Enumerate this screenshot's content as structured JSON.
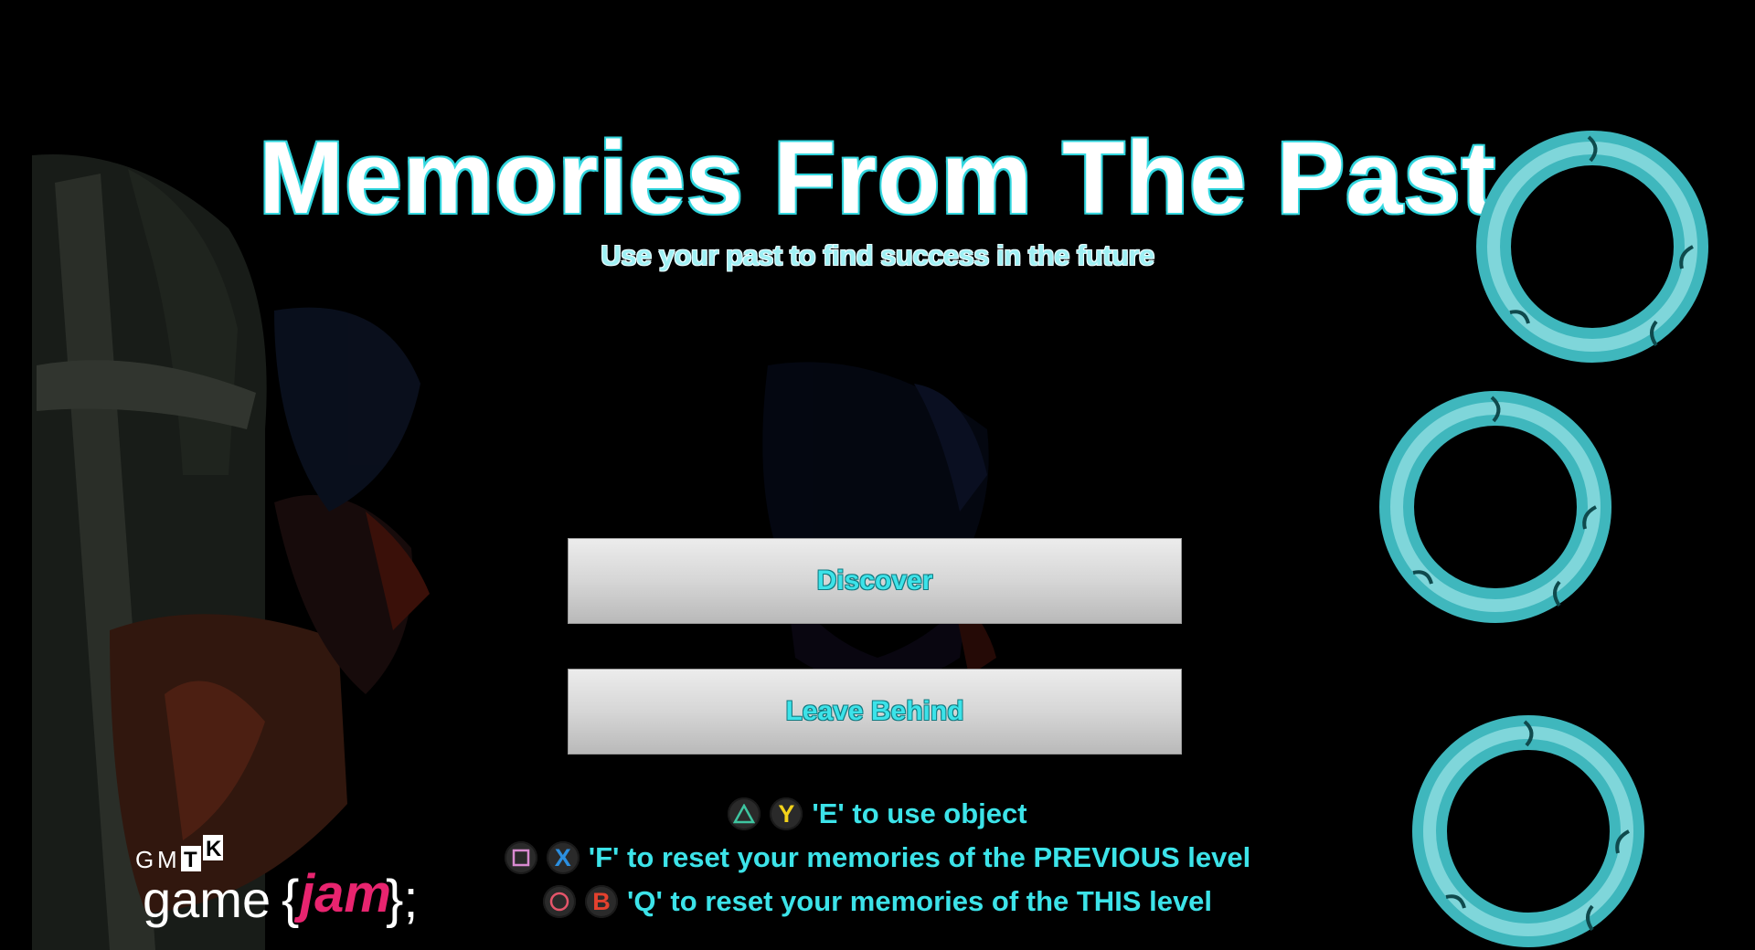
{
  "title": "Memories From The Past",
  "subtitle": "Use your past to find success in the future",
  "menu": {
    "discover_label": "Discover",
    "leave_label": "Leave Behind"
  },
  "hints": [
    {
      "ps_icon": "triangle-icon",
      "xbox_button": "Y",
      "xbox_color": "#f2d21a",
      "text": "'E' to use object"
    },
    {
      "ps_icon": "square-icon",
      "xbox_button": "X",
      "xbox_color": "#2b8fe0",
      "text": "'F' to reset your memories of the PREVIOUS level"
    },
    {
      "ps_icon": "circle-icon",
      "xbox_button": "B",
      "xbox_color": "#e4412e",
      "text": "'Q' to reset your memories of the THIS level"
    }
  ],
  "logo": {
    "letters": [
      "G",
      "M",
      "T",
      "K"
    ],
    "word_game": "game",
    "word_jam": "jam",
    "brace_open": "{",
    "brace_close": "};"
  },
  "colors": {
    "accent": "#3ce3e9",
    "ring": "#3fb7bd",
    "ring_light": "#7fd6da",
    "jam_pink": "#e8246f"
  }
}
